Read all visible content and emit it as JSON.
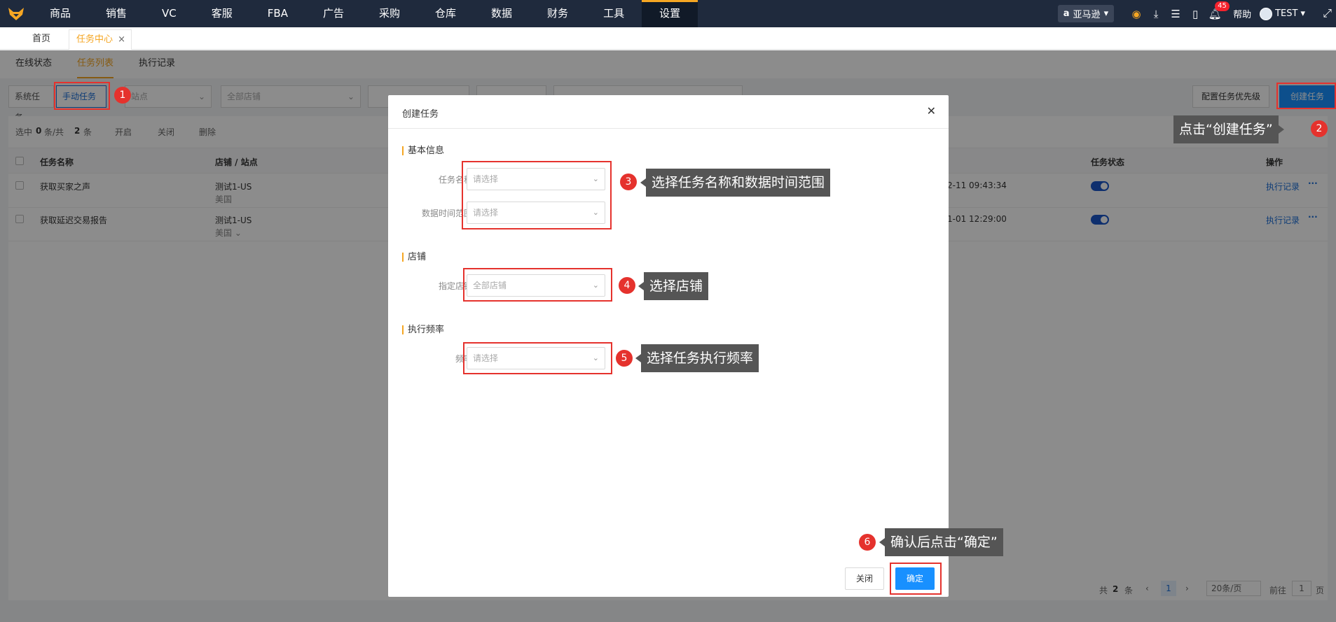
{
  "nav": {
    "items": [
      "商品",
      "销售",
      "VC",
      "客服",
      "FBA",
      "广告",
      "采购",
      "仓库",
      "数据",
      "财务",
      "工具",
      "设置"
    ],
    "active_index": 11,
    "store": "亚马逊",
    "badge": "45",
    "help": "帮助",
    "user": "TEST"
  },
  "page_tabs": {
    "home": "首页",
    "task_center": "任务中心",
    "close": "×"
  },
  "sub_tabs": [
    "在线状态",
    "任务列表",
    "执行记录"
  ],
  "filters": {
    "system_task": "系统任务",
    "manual_task": "手动任务",
    "site": "站点",
    "all_stores": "全部店铺",
    "configure_priority": "配置任务优先级",
    "create_task": "创建任务"
  },
  "selection": {
    "selected_prefix": "选中",
    "selected_count": "0",
    "selected_suffix": "条/共",
    "total": "2",
    "total_suffix": "条",
    "actions": [
      "开启",
      "关闭",
      "删除"
    ]
  },
  "table": {
    "headers": {
      "name": "任务名称",
      "store": "店铺 / 站点",
      "status": "任务状态",
      "ops": "操作"
    },
    "rows": [
      {
        "name": "获取买家之声",
        "store": "测试1-US",
        "site": "美国",
        "time": "2-11 09:43:34",
        "op": "执行记录"
      },
      {
        "name": "获取延迟交易报告",
        "store": "测试1-US",
        "site": "美国",
        "time": "1-01 12:29:00",
        "op": "执行记录"
      }
    ]
  },
  "pager": {
    "total_prefix": "共",
    "total": "2",
    "total_suffix": "条",
    "page": "1",
    "per_page": "20条/页",
    "goto": "前往",
    "goto_page": "1",
    "page_suffix": "页"
  },
  "modal": {
    "title": "创建任务",
    "sections": {
      "basic": "基本信息",
      "store": "店铺",
      "frequency": "执行频率"
    },
    "fields": {
      "task_name_label": "任务名称",
      "task_name_placeholder": "请选择",
      "time_range_label": "数据时间范围",
      "time_range_placeholder": "请选择",
      "store_label": "指定店铺",
      "store_value": "全部店铺",
      "freq_label": "频率",
      "freq_placeholder": "请选择"
    },
    "cancel": "关闭",
    "confirm": "确定"
  },
  "annotations": [
    {
      "num": "1"
    },
    {
      "num": "2",
      "text": "点击“创建任务”"
    },
    {
      "num": "3",
      "text": "选择任务名称和数据时间范围"
    },
    {
      "num": "4",
      "text": "选择店铺"
    },
    {
      "num": "5",
      "text": "选择任务执行频率"
    },
    {
      "num": "6",
      "text": "确认后点击“确定”"
    }
  ]
}
